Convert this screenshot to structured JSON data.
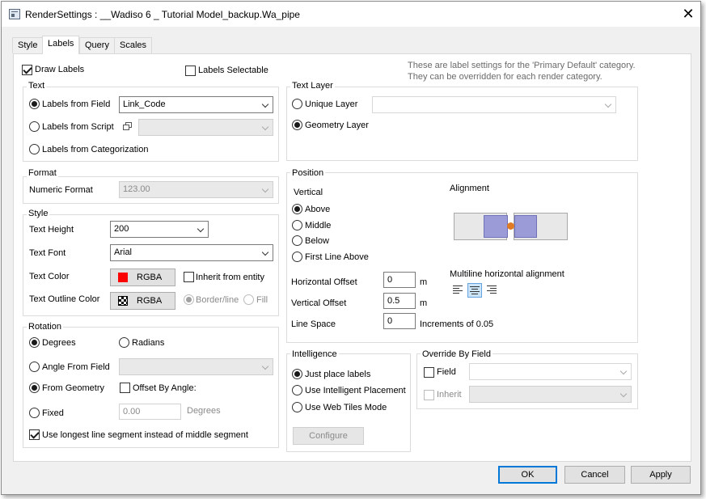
{
  "window": {
    "title": "RenderSettings : __Wadiso 6 _ Tutorial Model_backup.Wa_pipe"
  },
  "tabs": [
    "Style",
    "Labels",
    "Query",
    "Scales"
  ],
  "active_tab": "Labels",
  "top": {
    "draw_labels": "Draw Labels",
    "labels_selectable": "Labels Selectable",
    "hint_line1": "These are label settings for the 'Primary Default' category.",
    "hint_line2": "They can be overridden for each render category."
  },
  "text_group": {
    "legend": "Text",
    "from_field": "Labels from Field",
    "field_value": "Link_Code",
    "from_script": "Labels from Script",
    "from_categorization": "Labels from Categorization"
  },
  "format_group": {
    "legend": "Format",
    "numeric_format_label": "Numeric Format",
    "numeric_format_value": "123.00"
  },
  "style_group": {
    "legend": "Style",
    "text_height_label": "Text Height",
    "text_height_value": "200",
    "text_font_label": "Text Font",
    "text_font_value": "Arial",
    "text_color_label": "Text Color",
    "text_color_button": "RGBA",
    "text_color_swatch": "#ff0000",
    "inherit_from_entity": "Inherit from entity",
    "outline_color_label": "Text Outline Color",
    "outline_color_button": "RGBA",
    "border_line": "Border/line",
    "fill": "Fill"
  },
  "rotation_group": {
    "legend": "Rotation",
    "degrees": "Degrees",
    "radians": "Radians",
    "angle_from_field": "Angle From Field",
    "from_geometry": "From Geometry",
    "offset_by_angle": "Offset By Angle:",
    "fixed": "Fixed",
    "fixed_value": "0.00",
    "fixed_unit": "Degrees",
    "use_longest": "Use longest line segment instead of middle segment"
  },
  "text_layer_group": {
    "legend": "Text Layer",
    "unique_layer": "Unique Layer",
    "geometry_layer": "Geometry Layer"
  },
  "position_group": {
    "legend": "Position",
    "vertical_label": "Vertical",
    "above": "Above",
    "middle": "Middle",
    "below": "Below",
    "first_line_above": "First Line Above",
    "alignment_label": "Alignment",
    "multiline_label": "Multiline horizontal alignment",
    "horizontal_offset_label": "Horizontal Offset",
    "horizontal_offset_value": "0",
    "horizontal_offset_unit": "m",
    "vertical_offset_label": "Vertical Offset",
    "vertical_offset_value": "0.5",
    "vertical_offset_unit": "m",
    "line_space_label": "Line Space",
    "line_space_value": "0",
    "line_space_unit": "Increments of 0.05"
  },
  "intelligence_group": {
    "legend": "Intelligence",
    "just_place": "Just place labels",
    "intelligent": "Use Intelligent Placement",
    "web_tiles": "Use Web Tiles Mode",
    "configure": "Configure"
  },
  "override_group": {
    "legend": "Override By Field",
    "field": "Field",
    "inherit": "Inherit"
  },
  "footer": {
    "ok": "OK",
    "cancel": "Cancel",
    "apply": "Apply"
  },
  "colors": {
    "accent": "#0078d7",
    "alignment_box": "#9b9bd8",
    "alignment_dot": "#e07b24"
  }
}
